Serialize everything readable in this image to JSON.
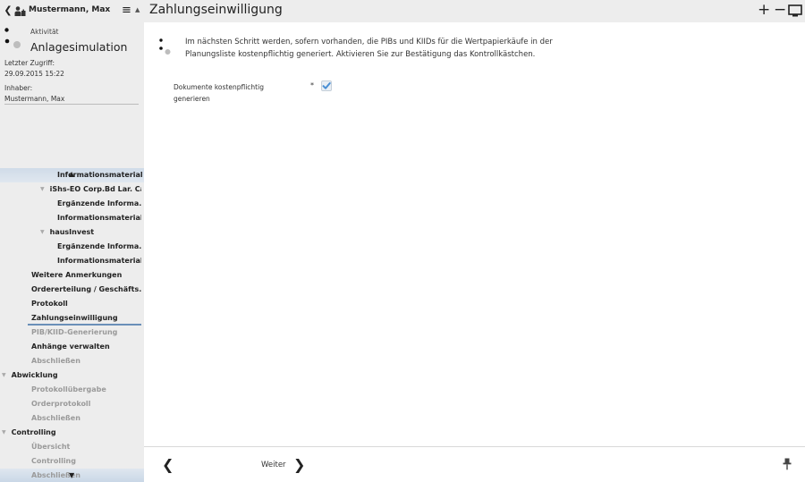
{
  "sidebar": {
    "user_name": "Mustermann, Max",
    "activity_label": "Aktivität",
    "activity_value": "Anlagesimulation",
    "last_access_label": "Letzter Zugriff:",
    "last_access_value": "29.09.2015 15:22",
    "owner_label": "Inhaber:",
    "owner_value": "Mustermann, Max",
    "nav": [
      {
        "label": "Informationsmaterial",
        "indent": 3,
        "style": "bold",
        "highlight": "top"
      },
      {
        "label": "iShs-EO Corp.Bd Lar. Ca...",
        "indent": 2,
        "style": "bold",
        "expand": true
      },
      {
        "label": "Ergänzende Informa...",
        "indent": 3,
        "style": "bold"
      },
      {
        "label": "Informationsmaterial",
        "indent": 3,
        "style": "bold"
      },
      {
        "label": "hausInvest",
        "indent": 2,
        "style": "bold",
        "expand": true
      },
      {
        "label": "Ergänzende Informa...",
        "indent": 3,
        "style": "bold"
      },
      {
        "label": "Informationsmaterial",
        "indent": 3,
        "style": "bold"
      },
      {
        "label": "Weitere Anmerkungen",
        "indent": 1,
        "style": "bold"
      },
      {
        "label": "Ordererteilung / Geschäfts...",
        "indent": 1,
        "style": "bold"
      },
      {
        "label": "Protokoll",
        "indent": 1,
        "style": "bold"
      },
      {
        "label": "Zahlungseinwilligung",
        "indent": 1,
        "style": "bold",
        "active": true
      },
      {
        "label": "PIB/KIID-Generierung",
        "indent": 1,
        "style": "dis"
      },
      {
        "label": "Anhänge verwalten",
        "indent": 1,
        "style": "bold"
      },
      {
        "label": "Abschließen",
        "indent": 1,
        "style": "dis"
      },
      {
        "label": "Abwicklung",
        "indent": 0,
        "style": "bold",
        "expand": true
      },
      {
        "label": "Protokollübergabe",
        "indent": 1,
        "style": "dis"
      },
      {
        "label": "Orderprotokoll",
        "indent": 1,
        "style": "dis"
      },
      {
        "label": "Abschließen",
        "indent": 1,
        "style": "dis"
      },
      {
        "label": "Controlling",
        "indent": 0,
        "style": "bold",
        "expand": true
      },
      {
        "label": "Übersicht",
        "indent": 1,
        "style": "dis"
      },
      {
        "label": "Controlling",
        "indent": 1,
        "style": "dis"
      },
      {
        "label": "Abschließen",
        "indent": 1,
        "style": "dis",
        "highlight": "bot"
      }
    ]
  },
  "header": {
    "title": "Zahlungseinwilligung",
    "plus": "+",
    "minus": "−"
  },
  "main": {
    "hint": "Im nächsten Schritt werden, sofern vorhanden, die PIBs und KIIDs für die Wertpapierkäufe in der Planungsliste kostenpflichtig generiert. Aktivieren Sie zur Bestätigung das Kontrollkästchen.",
    "field_label": "Dokumente kostenpflichtig generieren",
    "required_mark": "*",
    "checkbox_checked": true
  },
  "footer": {
    "next_label": "Weiter"
  },
  "colors": {
    "sidebar_bg": "#ededed",
    "active_underline": "#6a8fb8",
    "check_color": "#4a8fd4",
    "disabled_text": "#9a9a9a"
  }
}
